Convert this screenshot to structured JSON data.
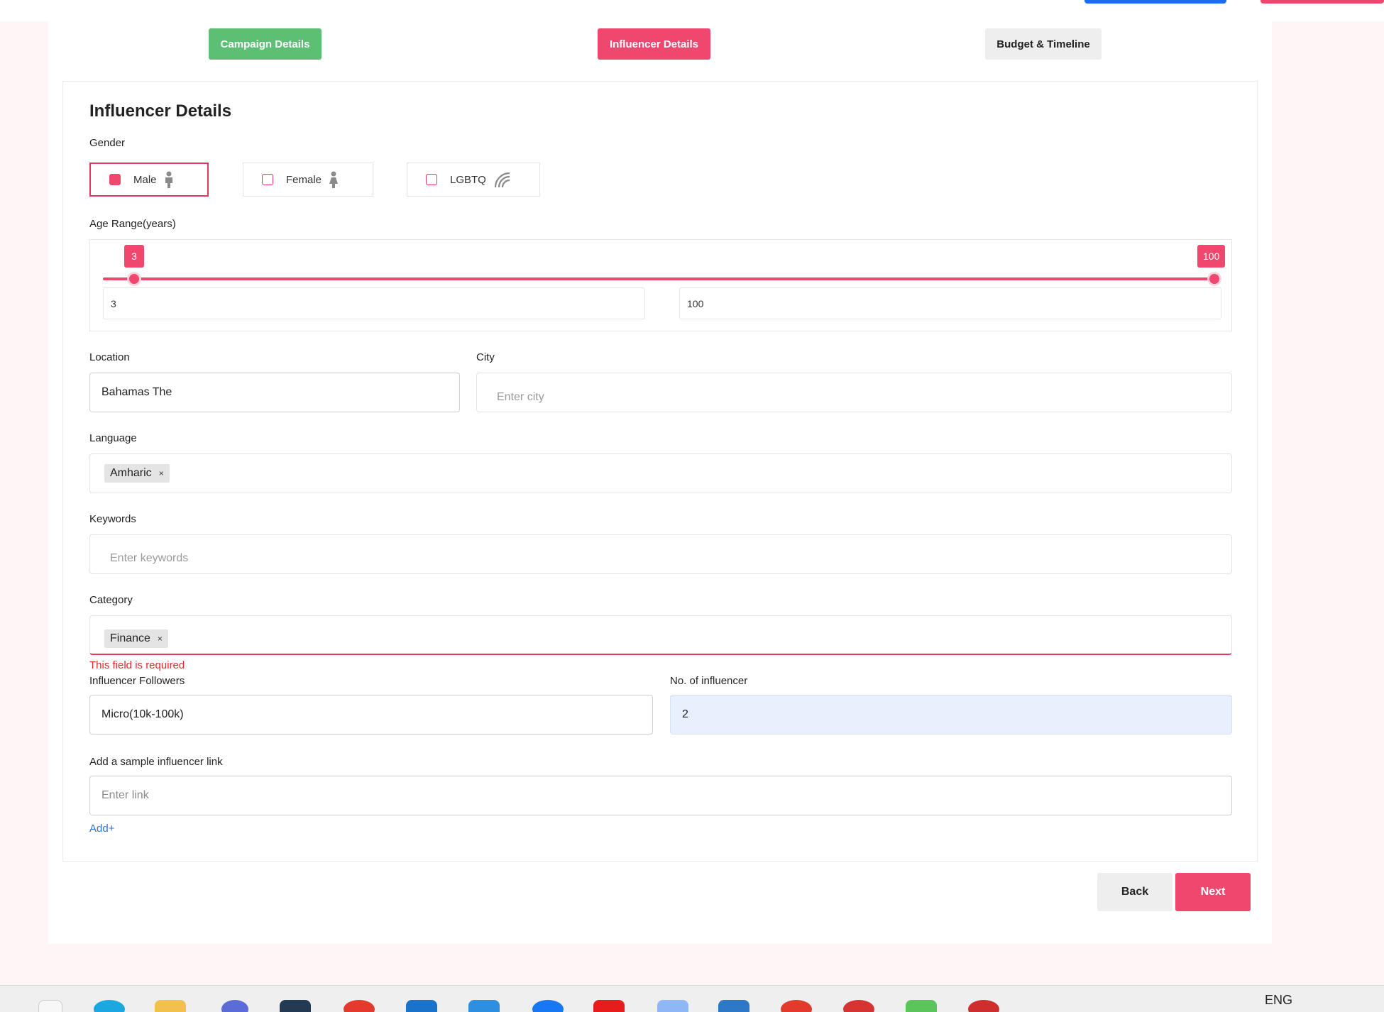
{
  "steps": {
    "campaign": "Campaign Details",
    "influencer": "Influencer Details",
    "budget": "Budget & Timeline"
  },
  "form": {
    "title": "Influencer Details",
    "gender": {
      "label": "Gender",
      "options": [
        {
          "label": "Male",
          "checked": true,
          "icon": "male-person-icon"
        },
        {
          "label": "Female",
          "checked": false,
          "icon": "female-person-icon"
        },
        {
          "label": "LGBTQ",
          "checked": false,
          "icon": "rainbow-icon"
        }
      ]
    },
    "age_range": {
      "label": "Age Range(years)",
      "min": 3,
      "max": 100,
      "min_display": "3",
      "max_display": "100",
      "range_min": 3,
      "range_max": 100
    },
    "location": {
      "label": "Location",
      "value": "Bahamas The"
    },
    "city": {
      "label": "City",
      "placeholder": "Enter city"
    },
    "language": {
      "label": "Language",
      "chips": [
        "Amharic"
      ]
    },
    "keywords": {
      "label": "Keywords",
      "placeholder": "Enter keywords"
    },
    "category": {
      "label": "Category",
      "chips": [
        "Finance"
      ],
      "error": "This field is required"
    },
    "followers": {
      "label": "Influencer Followers",
      "value": "Micro(10k-100k)"
    },
    "num_influencer": {
      "label": "No. of influencer",
      "value": "2"
    },
    "sample_link": {
      "label": "Add a sample influencer link",
      "placeholder": "Enter link"
    },
    "add_label": "Add+",
    "chip_remove": "×"
  },
  "buttons": {
    "back": "Back",
    "next": "Next"
  },
  "taskbar": {
    "language": "ENG"
  },
  "colors": {
    "accent": "#f0476f",
    "success": "#5cbf73",
    "error": "#e02b2b",
    "link": "#2e73d6"
  }
}
